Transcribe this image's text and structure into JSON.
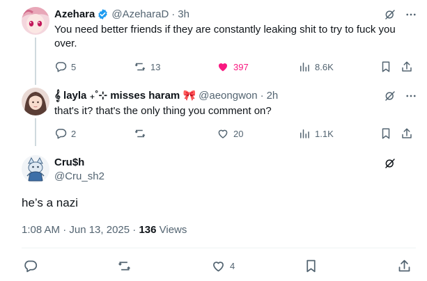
{
  "replies": [
    {
      "display_name": "Azehara",
      "handle": "@AzeharaD",
      "separator": "·",
      "time": "3h",
      "text": "You need better friends if they are constantly leaking shit to try to fuck you over.",
      "stats": {
        "replies": "5",
        "reposts": "13",
        "likes": "397",
        "views": "8.6K"
      },
      "liked": true,
      "verified": true,
      "accent_color": "#f91880"
    },
    {
      "display_name": "𝄞 layla ₊˚⊹ misses haram 🎀",
      "handle": "@aeongwon",
      "separator": "·",
      "time": "2h",
      "text": "that's it? that's the only thing you comment on?",
      "stats": {
        "replies": "2",
        "reposts": "",
        "likes": "20",
        "views": "1.1K"
      },
      "liked": false,
      "verified": false
    }
  ],
  "main_post": {
    "display_name": "Cru$h",
    "handle": "@Cru_sh2",
    "text": "he’s a nazi",
    "timestamp": "1:08 AM · Jun 13, 2025 · ",
    "views_count": "136",
    "views_label": " Views",
    "stats": {
      "likes": "4"
    }
  },
  "colors": {
    "text_primary": "#0f1419",
    "text_secondary": "#536471",
    "like_pink": "#f91880",
    "verified_blue": "#1d9bf0"
  },
  "icons": [
    "reply-icon",
    "repost-icon",
    "like-icon",
    "views-icon",
    "bookmark-icon",
    "share-icon",
    "grok-icon",
    "more-icon",
    "verified-icon"
  ]
}
